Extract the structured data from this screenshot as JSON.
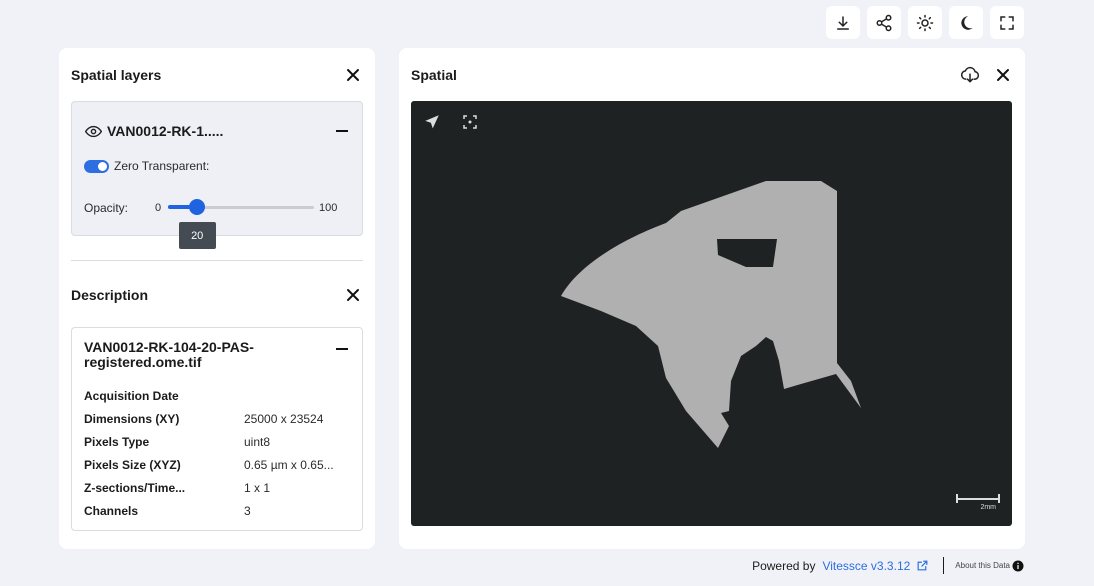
{
  "toolbar": {
    "buttons": [
      {
        "icon": "download-icon"
      },
      {
        "icon": "share-icon"
      },
      {
        "icon": "sun-icon"
      },
      {
        "icon": "moon-icon"
      },
      {
        "icon": "fullscreen-icon"
      }
    ]
  },
  "layers_panel": {
    "title": "Spatial layers",
    "layer": {
      "name": "VAN0012-RK-1.....",
      "visible_icon": "eye-icon",
      "zero_transparent_label": "Zero Transparent:",
      "zero_transparent": true,
      "opacity_label": "Opacity:",
      "opacity_min": "0",
      "opacity_max": "100",
      "opacity_value": 20,
      "opacity_value_text": "20"
    }
  },
  "description_panel": {
    "title": "Description",
    "file_name": "VAN0012-RK-104-20-PAS-registered.ome.tif",
    "rows": [
      {
        "key": "Acquisition Date",
        "value": ""
      },
      {
        "key": "Dimensions (XY)",
        "value": "25000 x 23524"
      },
      {
        "key": "Pixels Type",
        "value": "uint8"
      },
      {
        "key": "Pixels Size (XYZ)",
        "value": "0.65 µm x 0.65..."
      },
      {
        "key": "Z-sections/Time...",
        "value": "1 x 1"
      },
      {
        "key": "Channels",
        "value": "3"
      }
    ]
  },
  "spatial_panel": {
    "title": "Spatial",
    "scale_label": "2mm",
    "colors": {
      "viewer_bg": "#1f2223",
      "tissue": "#b0b0b0"
    }
  },
  "footer": {
    "powered_by": "Powered by",
    "version_link": "Vitessce v3.3.12",
    "about": "About this Data"
  },
  "colors": {
    "accent": "#2d6ee0",
    "background": "#f0f2f7"
  }
}
